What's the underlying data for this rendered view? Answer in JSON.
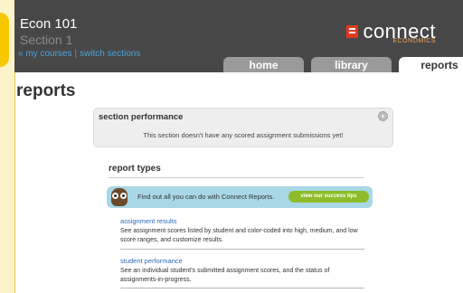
{
  "header": {
    "course_title": "Econ 101",
    "section_name": "Section 1",
    "my_courses_link": "« my courses",
    "separator": "|",
    "switch_sections_link": "switch sections",
    "brand": {
      "wordmark": "connect",
      "subject": "ECONOMICS",
      "logo_color": "#e03a1e"
    },
    "tabs": [
      {
        "label": "home",
        "active": false
      },
      {
        "label": "library",
        "active": false
      },
      {
        "label": "reports",
        "active": true
      }
    ]
  },
  "page": {
    "title": "reports"
  },
  "section_performance": {
    "title": "section performance",
    "message": "This section doesn't have any scored assignment submissions yet!",
    "icon": "gear-icon"
  },
  "report_types": {
    "title": "report types",
    "promo": {
      "text": "Find out all you can do with Connect Reports.",
      "button_label": "view our success tips",
      "icon": "owl-icon"
    },
    "items": [
      {
        "label": "assignment results",
        "description": "See assignment scores listed by student and color-coded into high, medium, and low score ranges, and customize results."
      },
      {
        "label": "student performance",
        "description": "See an individual student's submitted assignment scores, and the status of assignments-in-progress."
      }
    ]
  },
  "colors": {
    "header_bg": "#474747",
    "link": "#2a6bb5",
    "promo_bg": "#a8d7e5",
    "promo_button": "#8ebc2a"
  }
}
